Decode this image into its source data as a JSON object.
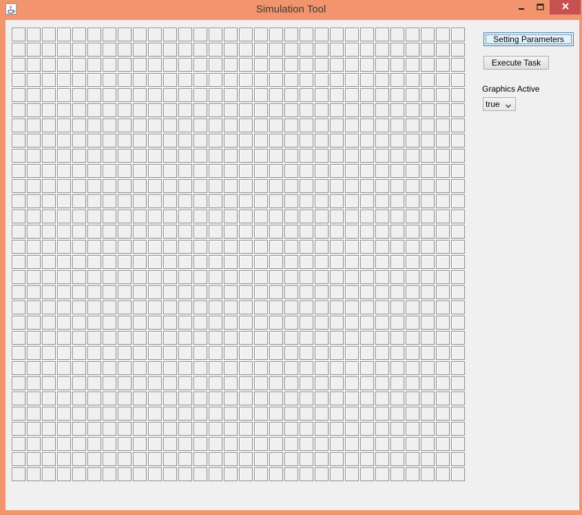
{
  "window": {
    "title": "Simulation Tool",
    "colors": {
      "frame": "#f2956e",
      "client": "#f0f0f0",
      "close": "#c75050"
    },
    "icons": {
      "app": "java-app-icon",
      "minimize": "minimize-icon",
      "maximize": "maximize-icon",
      "close": "close-icon"
    }
  },
  "grid": {
    "columns": 30,
    "rows": 30
  },
  "controls": {
    "settings_label": "Setting Parameters",
    "execute_label": "Execute Task",
    "graphics_label": "Graphics Active",
    "graphics_value": "true"
  }
}
